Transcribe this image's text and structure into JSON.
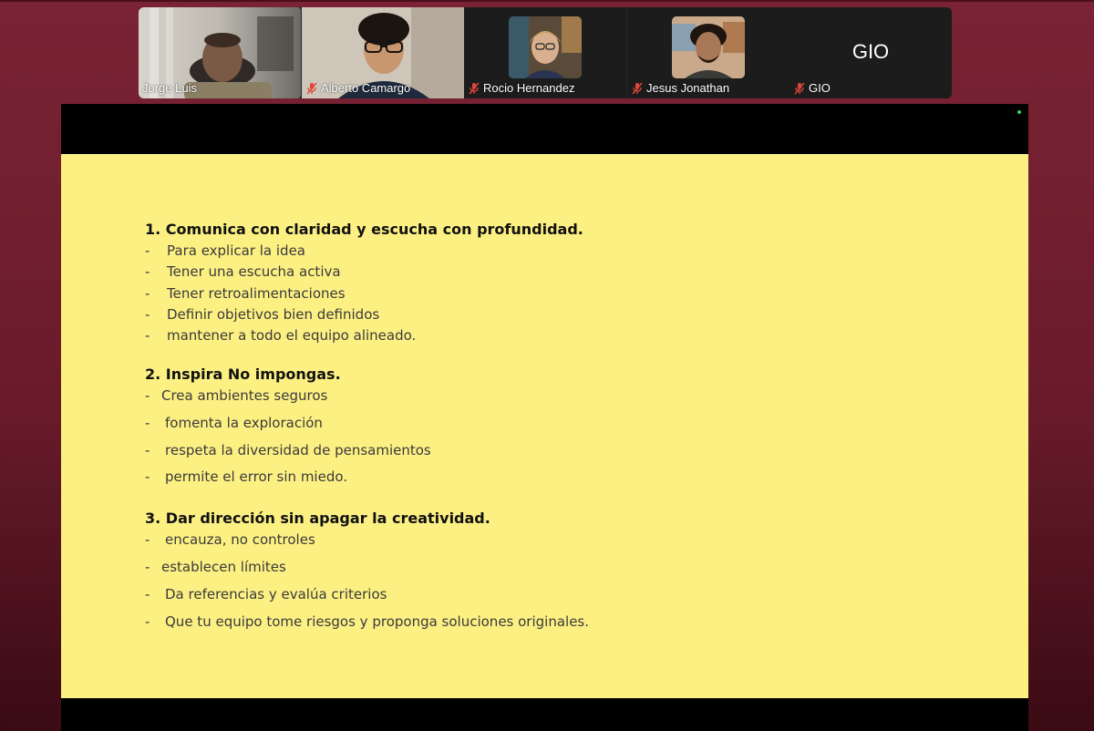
{
  "participants": [
    {
      "name": "Jorge Luis",
      "muted": false,
      "active": true
    },
    {
      "name": "Alberto Camargo",
      "muted": true,
      "active": false
    },
    {
      "name": "Rocio Hernandez",
      "muted": true,
      "active": false
    },
    {
      "name": "Jesus Jonathan",
      "muted": true,
      "active": false
    },
    {
      "name": "GIO",
      "muted": true,
      "active": false,
      "initials": "GIO"
    }
  ],
  "slide": {
    "sections": [
      {
        "title": "1. Comunica con claridad y escucha con profundidad.",
        "items": [
          "Para explicar la idea",
          "Tener una escucha activa",
          "Tener retroalimentaciones",
          "Definir objetivos bien definidos",
          "mantener a todo el equipo alineado."
        ]
      },
      {
        "title": "2. Inspira No impongas.",
        "items": [
          "Crea ambientes seguros",
          "fomenta la exploración",
          "respeta la diversidad de pensamientos",
          "permite el error sin miedo."
        ]
      },
      {
        "title": "3. Dar dirección sin apagar la creatividad.",
        "items": [
          "encauza, no controles",
          "establecen límites",
          "Da referencias y evalúa criterios",
          "Que tu equipo tome riesgos y proponga soluciones originales."
        ]
      }
    ],
    "dash": "-"
  },
  "colors": {
    "background": "#7a2334",
    "active_border": "#45c25a",
    "muted_icon": "#e0453a",
    "slide_bg": "#fdf083"
  }
}
